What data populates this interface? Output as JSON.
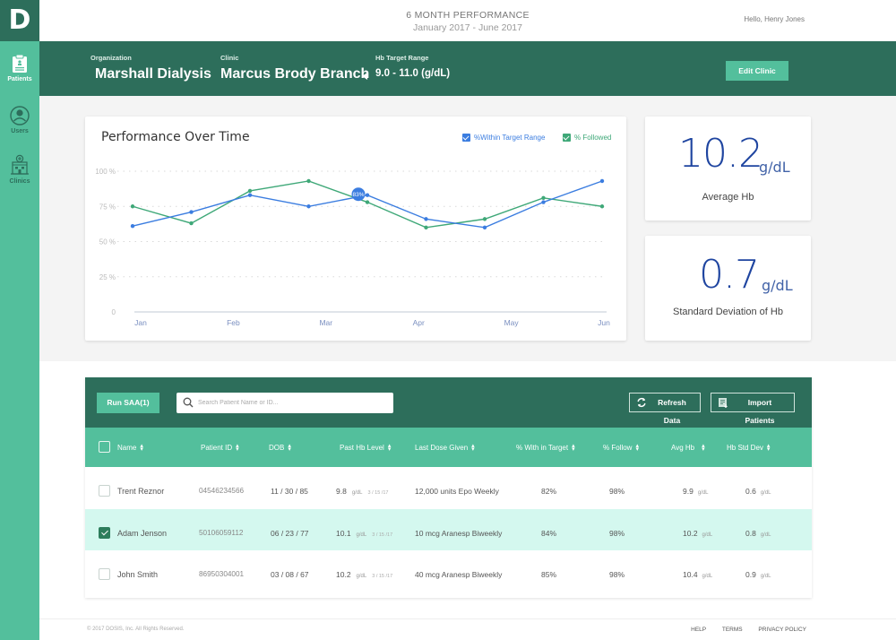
{
  "app": {
    "logo_letter": "D"
  },
  "sidebar": {
    "items": [
      {
        "label": "Patients",
        "icon": "clipboard-icon",
        "active": true
      },
      {
        "label": "Users",
        "icon": "user-circle-icon",
        "active": false
      },
      {
        "label": "Clinics",
        "icon": "hospital-icon",
        "active": false
      }
    ]
  },
  "header": {
    "period_title": "6 MONTH PERFORMANCE",
    "period_range": "January 2017 - June 2017",
    "greeting": "Hello,  Henry Jones"
  },
  "org_bar": {
    "organization_label": "Organization",
    "organization": "Marshall Dialysis",
    "clinic_label": "Clinic",
    "clinic": "Marcus Brody Branch",
    "target_label": "Hb Target Range",
    "target": "9.0 - 11.0 (g/dL)",
    "edit_button": "Edit Clinic"
  },
  "chart_data": {
    "type": "line",
    "title": "Performance Over Time",
    "xlabel": "",
    "ylabel": "",
    "x_tick_labels": [
      "Jan",
      "Feb",
      "Mar",
      "Apr",
      "May",
      "Jun"
    ],
    "y_tick_labels": [
      "0",
      "25 %",
      "50 %",
      "75 %",
      "100 %"
    ],
    "y_ticks": [
      0,
      25,
      50,
      75,
      100
    ],
    "ylim": [
      0,
      100
    ],
    "x_points": 9,
    "grid": true,
    "legend_position": "top-right",
    "series": [
      {
        "name": "%Within Target Range",
        "color": "#3b7de0",
        "checked": true,
        "values": [
          61,
          71,
          83,
          75,
          83,
          66,
          60,
          78,
          93
        ]
      },
      {
        "name": "% Followed",
        "color": "#3fa878",
        "checked": true,
        "values": [
          75,
          63,
          86,
          93,
          78,
          60,
          66,
          81,
          75
        ]
      }
    ],
    "tooltip": {
      "series": 0,
      "index": 4,
      "label": "83%"
    }
  },
  "stats": {
    "avg_hb": {
      "value": "10.2",
      "unit": "g/dL",
      "label": "Average Hb"
    },
    "std_dev": {
      "value": "0.7",
      "unit": "g/dL",
      "label": "Standard Deviation of Hb"
    }
  },
  "table": {
    "run_button": "Run SAA(1)",
    "search_placeholder": "Search Patient Name or ID...",
    "search_value": "",
    "refresh_button": "Refresh Data",
    "import_button": "Import Patients",
    "columns": [
      "Name",
      "Patient ID",
      "DOB",
      "Past Hb Level",
      "Last Dose Given",
      "% With in Target",
      "% Follow",
      "Avg Hb",
      "Hb Std Dev"
    ],
    "rows": [
      {
        "name": "Trent Reznor",
        "patient_id": "04546234566",
        "dob": "11 / 30 / 85",
        "past_hb": "9.8",
        "past_hb_unit": "g/dL",
        "past_hb_date": "3 / 15 /17",
        "last_dose": "12,000 units Epo Weekly",
        "within_target": "82%",
        "follow": "98%",
        "avg_hb": "9.9",
        "avg_hb_unit": "g/dL",
        "std_dev": "0.6",
        "std_dev_unit": "g/dL",
        "selected": false
      },
      {
        "name": "Adam Jenson",
        "patient_id": "50106059112",
        "dob": "06 / 23 / 77",
        "past_hb": "10.1",
        "past_hb_unit": "g/dL",
        "past_hb_date": "3 / 15 /17",
        "last_dose": "10 mcg Aranesp Biweekly",
        "within_target": "84%",
        "follow": "98%",
        "avg_hb": "10.2",
        "avg_hb_unit": "g/dL",
        "std_dev": "0.8",
        "std_dev_unit": "g/dL",
        "selected": true
      },
      {
        "name": "John Smith",
        "patient_id": "86950304001",
        "dob": "03 / 08 / 67",
        "past_hb": "10.2",
        "past_hb_unit": "g/dL",
        "past_hb_date": "3 / 15 /17",
        "last_dose": "40 mcg Aranesp Biweekly",
        "within_target": "85%",
        "follow": "98%",
        "avg_hb": "10.4",
        "avg_hb_unit": "g/dL",
        "std_dev": "0.9",
        "std_dev_unit": "g/dL",
        "selected": false
      }
    ]
  },
  "footer": {
    "copyright": "© 2017 DOSIS, Inc. All Rights Reserved.",
    "links": [
      "HELP",
      "TERMS",
      "PRIVACY POLICY"
    ]
  },
  "colors": {
    "dark_green": "#2d6e5b",
    "light_green": "#53bf9c",
    "selected_row": "#d4f8ef",
    "stat_blue": "#1f45a0"
  }
}
